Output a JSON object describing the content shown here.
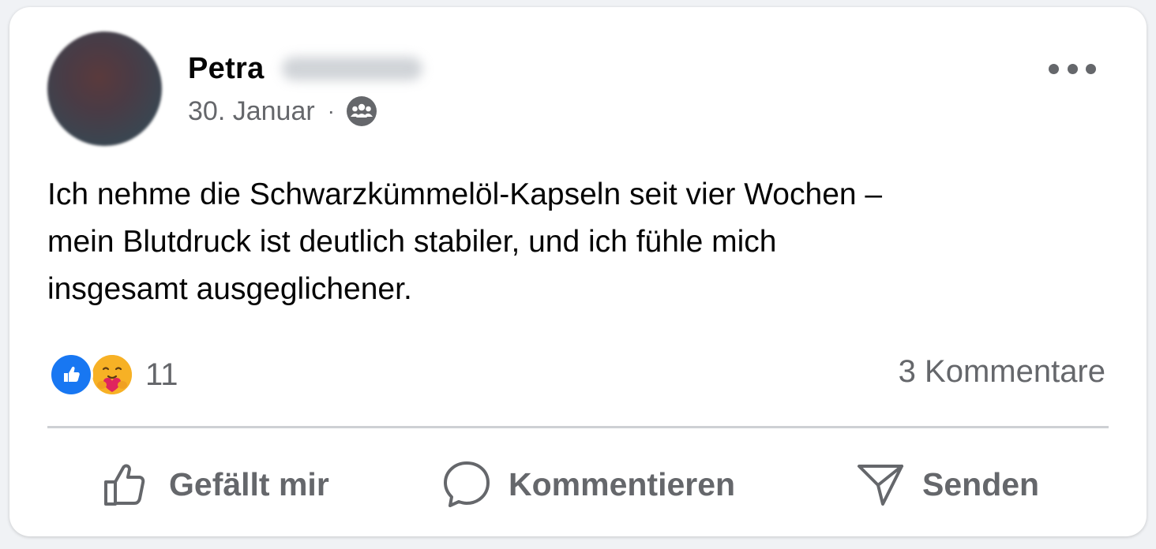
{
  "post": {
    "author_first_name": "Petra",
    "date": "30. Januar",
    "separator": "·",
    "audience_icon": "group-icon",
    "more_icon": "more-horizontal-icon",
    "text": "Ich nehme die Schwarzkümmelöl-Kapseln seit vier Wochen –\nmein Blutdruck ist deutlich stabiler, und ich fühle mich\ninsgesamt ausgeglichener."
  },
  "reactions": {
    "types": [
      "like",
      "care"
    ],
    "count": "11",
    "comments_label": "3 Kommentare"
  },
  "actions": {
    "like_label": "Gefällt mir",
    "comment_label": "Kommentieren",
    "send_label": "Senden"
  },
  "colors": {
    "text_primary": "#050505",
    "text_secondary": "#65676b",
    "like_blue": "#1877f2",
    "care_yellow": "#f7b125",
    "divider": "#ced0d4"
  }
}
